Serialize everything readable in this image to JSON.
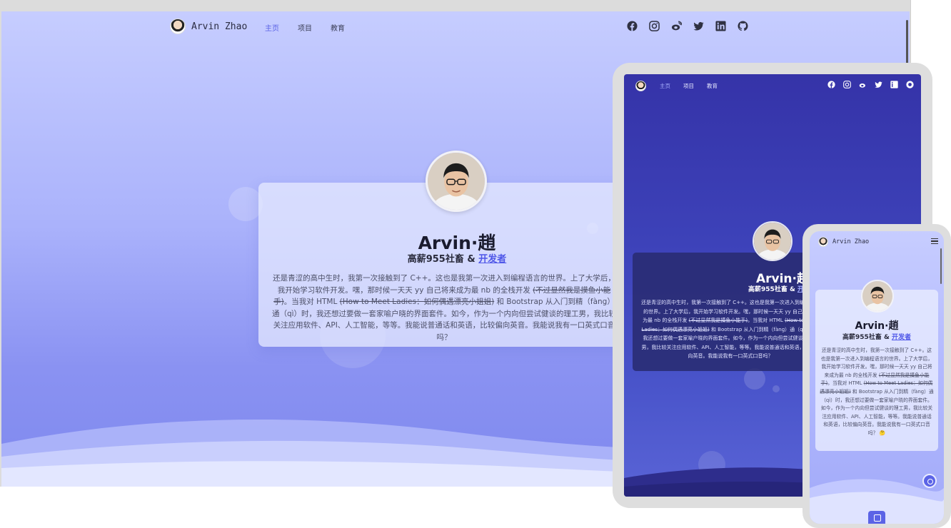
{
  "site": {
    "brand_name": "Arvin Zhao",
    "nav": [
      {
        "label": "主页",
        "active": true
      },
      {
        "label": "项目",
        "active": false
      },
      {
        "label": "教育",
        "active": false
      }
    ],
    "social_icons": [
      "facebook-icon",
      "instagram-icon",
      "weibo-icon",
      "twitter-icon",
      "linkedin-icon",
      "github-icon"
    ]
  },
  "profile": {
    "name": "Arvin·趙",
    "subtitle_prefix": "高薪955社畜 & ",
    "subtitle_link": "开发者",
    "bio": {
      "p1": "还是青涩的高中生时，我第一次接触到了 C++。这也是我第一次进入到编程语言的世界。上了大学后，我开始学习软件开发。嘿，那时候一天天 yy 自己将来成为最 nb 的全栈开发 ",
      "s1": "(不过显然我是摸鱼小能手)",
      "p2": "。当我对 HTML ",
      "s2": "(How to Meet Ladies：如何偶遇漂亮小姐姐)",
      "p3": " 和 Bootstrap 从入门到精（fàng）通（qì）时，我还想过要做一套家喻户晓的界面套件。如今，作为一个内向但尝试健谈的理工男，我比较关注应用软件、API、人工智能，等等。我能说普通话和英语，比较偏向英音。我能说我有一口英式口音吗？",
      "emoji": "🤔"
    }
  },
  "colors": {
    "accent": "#5b63e6",
    "desktop_bg_top": "#c6cdff",
    "desktop_bg_bottom": "#7f89ee",
    "tablet_bg": "#3533a8"
  }
}
